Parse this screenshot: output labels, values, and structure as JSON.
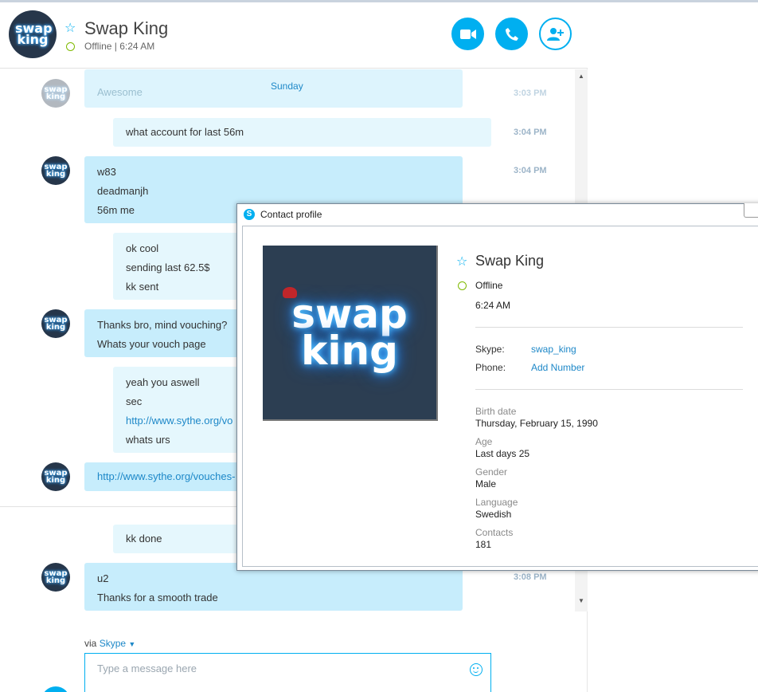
{
  "header": {
    "name": "Swap King",
    "status": "Offline | 6:24 AM",
    "avatar_text": "swap king",
    "buttons": [
      "video-call",
      "audio-call",
      "add-contact"
    ]
  },
  "conversation": {
    "day_label": "Sunday",
    "ghost_text": "Awesome",
    "ghost_time": "3:03 PM",
    "messages": [
      {
        "from": "me",
        "lines": [
          "what account for last 56m"
        ],
        "time": "3:04 PM"
      },
      {
        "from": "them",
        "lines": [
          "w83",
          "deadmanjh",
          "56m me"
        ],
        "time": "3:04 PM"
      },
      {
        "from": "me",
        "lines": [
          "ok cool",
          "sending last 62.5$",
          "kk sent"
        ]
      },
      {
        "from": "them",
        "lines": [
          "Thanks bro, mind vouching?",
          "Whats your vouch page"
        ]
      },
      {
        "from": "me",
        "lines": [
          "yeah you aswell",
          "sec",
          "http://www.sythe.org/vo",
          "whats urs"
        ]
      },
      {
        "from": "them",
        "lines": [
          "http://www.sythe.org/vouches-"
        ]
      },
      {
        "from": "me",
        "lines": [
          "kk done"
        ]
      },
      {
        "from": "them",
        "lines": [
          "u2",
          "Thanks for a smooth trade"
        ],
        "time": "3:08 PM"
      }
    ]
  },
  "composer": {
    "via_prefix": "via",
    "via_service": "Skype",
    "placeholder": "Type a message here"
  },
  "profile": {
    "window_title": "Contact profile",
    "name": "Swap King",
    "status": "Offline",
    "local_time": "6:24 AM",
    "photo_text": "swap king",
    "skype_key": "Skype:",
    "skype_value": "swap_king",
    "phone_key": "Phone:",
    "phone_value": "Add Number",
    "fields": [
      {
        "label": "Birth date",
        "value": "Thursday, February 15, 1990"
      },
      {
        "label": "Age",
        "value": "Last days 25"
      },
      {
        "label": "Gender",
        "value": "Male"
      },
      {
        "label": "Language",
        "value": "Swedish"
      },
      {
        "label": "Contacts",
        "value": "181"
      }
    ]
  },
  "colors": {
    "accent": "#00aff0",
    "online_ring": "#7fba00",
    "bubble_them": "#c7edfc",
    "bubble_me": "#e5f7fd",
    "link": "#1e88c8"
  }
}
